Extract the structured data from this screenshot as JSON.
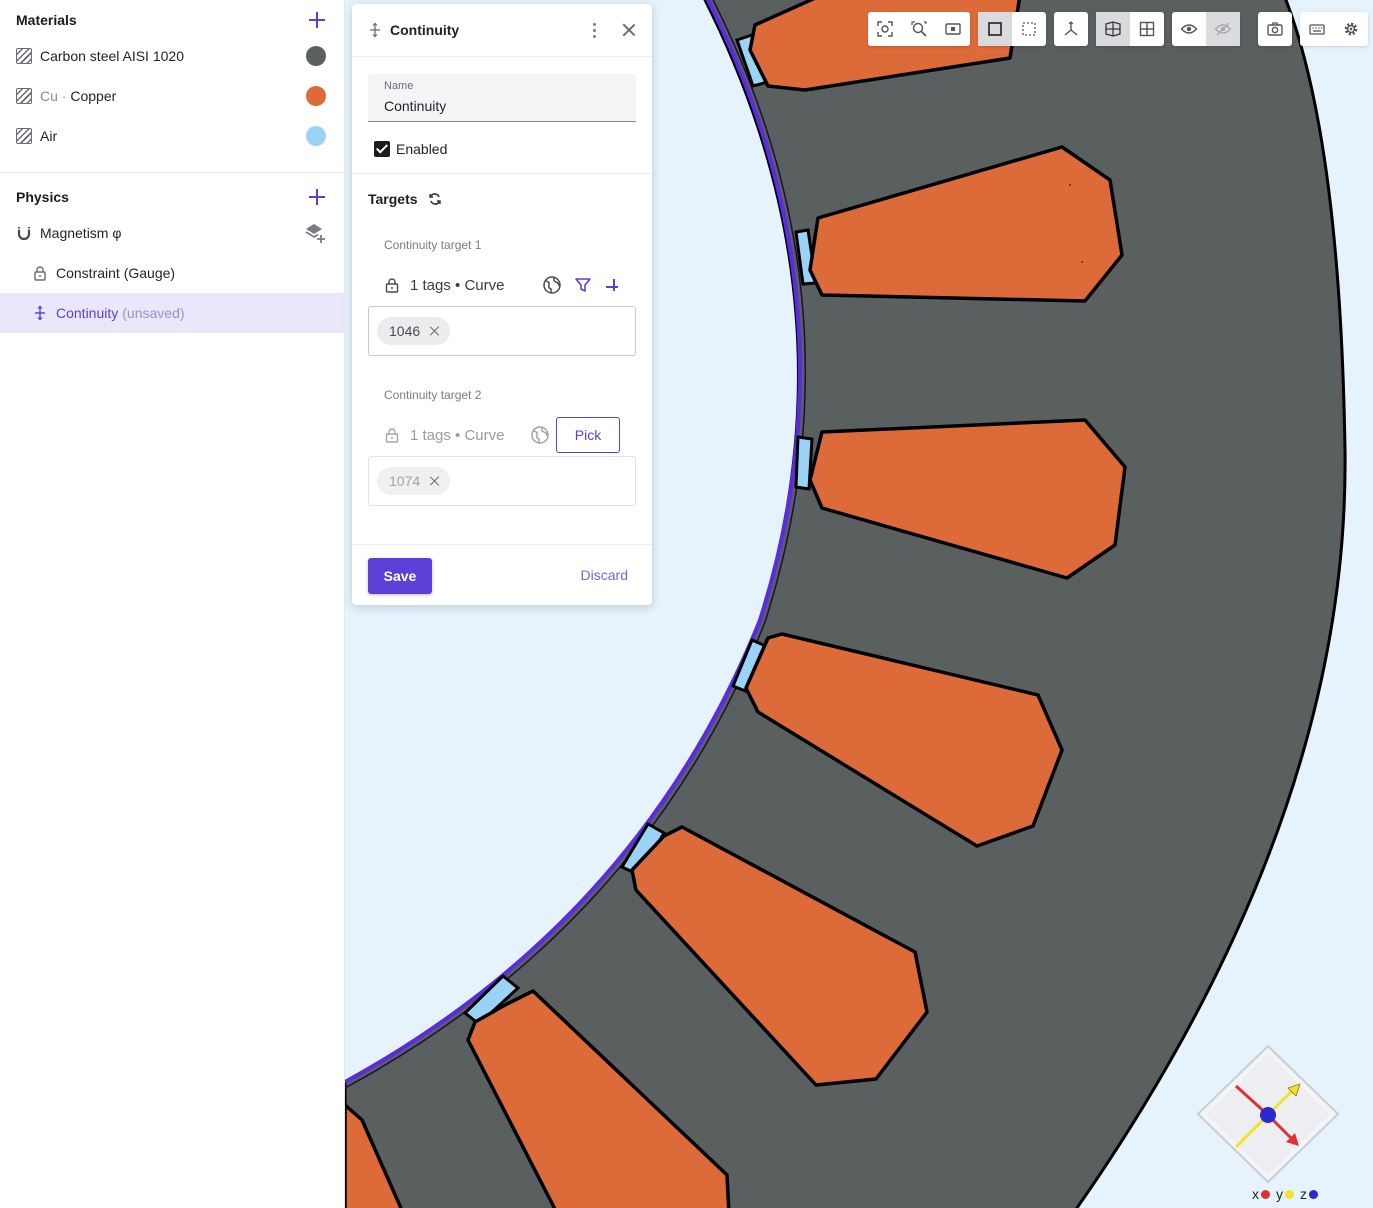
{
  "materials": {
    "title": "Materials",
    "items": [
      {
        "name": "Carbon steel AISI 1020",
        "color": "#5a5f5f"
      },
      {
        "prefix": "Cu",
        "sep": " · ",
        "name": "Copper",
        "color": "#dd6b3a"
      },
      {
        "name": "Air",
        "color": "#9ad3f5"
      }
    ]
  },
  "physics": {
    "title": "Physics",
    "items": [
      {
        "name": "Magnetism φ"
      },
      {
        "name": "Constraint (Gauge)"
      },
      {
        "name": "Continuity",
        "suffix": "(unsaved)"
      }
    ]
  },
  "dialog": {
    "title": "Continuity",
    "name_label": "Name",
    "name_value": "Continuity",
    "enabled_label": "Enabled",
    "targets_title": "Targets",
    "target1": {
      "label": "Continuity target 1",
      "summary": "1 tags • Curve",
      "tag": "1046"
    },
    "target2": {
      "label": "Continuity target 2",
      "summary": "1 tags • Curve",
      "tag": "1074",
      "pick_label": "Pick"
    },
    "save_label": "Save",
    "discard_label": "Discard"
  },
  "triad": {
    "x_label": "x",
    "y_label": "y",
    "z_label": "z",
    "x_color": "#e03131",
    "y_color": "#f5e02a",
    "z_color": "#2a2ad0"
  },
  "colors": {
    "accent": "#5b3fd6",
    "steel": "#5a5f5f",
    "copper": "#dd6b3a",
    "air": "#9ad3f5",
    "background": "#e6f3fd"
  }
}
